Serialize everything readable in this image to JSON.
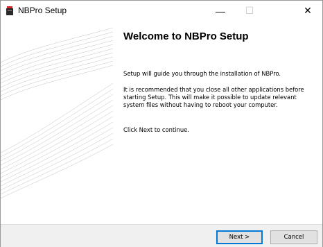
{
  "window": {
    "title": "NBPro Setup",
    "minimize_glyph": "—",
    "maximize_glyph": "☐",
    "close_glyph": "✕",
    "app_icon": "installer-icon"
  },
  "main": {
    "heading": "Welcome to NBPro Setup",
    "paragraphs": [
      "Setup will guide you through the installation of NBPro.",
      "It is recommended that you close all other applications before starting Setup. This will make it possible to update relevant system files without having to reboot your computer.",
      "Click Next to continue."
    ]
  },
  "footer": {
    "next_label": "Next >",
    "cancel_label": "Cancel"
  },
  "colors": {
    "accent": "#0078d7",
    "footer_bg": "#f0f0f0",
    "icon_red": "#d42a2a"
  }
}
